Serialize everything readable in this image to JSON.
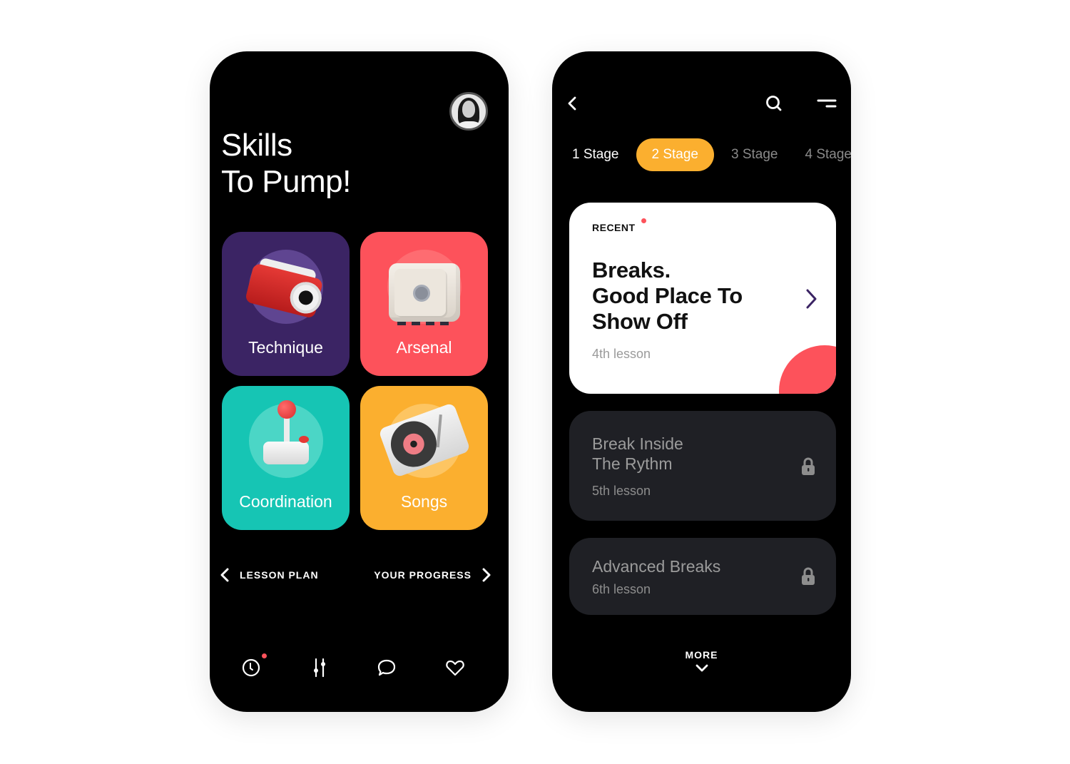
{
  "left_screen": {
    "title_lines": [
      "Skills",
      "To Pump!"
    ],
    "avatar": "user-avatar",
    "tiles": [
      {
        "label": "Technique",
        "icon": "camera-icon",
        "color": "#3b2464"
      },
      {
        "label": "Arsenal",
        "icon": "safe-icon",
        "color": "#fd525b"
      },
      {
        "label": "Coordination",
        "icon": "joystick-icon",
        "color": "#16c5b4"
      },
      {
        "label": "Songs",
        "icon": "turntable-icon",
        "color": "#fbaf2f"
      }
    ],
    "nav": {
      "prev_label": "LESSON PLAN",
      "next_label": "YOUR PROGRESS"
    },
    "tabbar": [
      {
        "icon": "clock-icon",
        "has_notification": true
      },
      {
        "icon": "sliders-icon"
      },
      {
        "icon": "chat-icon"
      },
      {
        "icon": "heart-icon"
      }
    ]
  },
  "right_screen": {
    "topbar": {
      "back_icon": "chevron-left-icon",
      "search_icon": "search-icon",
      "menu_icon": "menu-icon"
    },
    "stages": [
      {
        "label": "1 Stage",
        "state": "done"
      },
      {
        "label": "2 Stage",
        "state": "active"
      },
      {
        "label": "3 Stage",
        "state": "locked"
      },
      {
        "label": "4 Stage",
        "state": "locked"
      }
    ],
    "recent_card": {
      "badge": "RECENT",
      "title_lines": [
        "Breaks.",
        "Good Place To",
        "Show Off"
      ],
      "subtitle": "4th lesson"
    },
    "lessons": [
      {
        "title_lines": [
          "Break Inside",
          "The Rythm"
        ],
        "subtitle": "5th lesson",
        "locked": true
      },
      {
        "title_lines": [
          "Advanced Breaks"
        ],
        "subtitle": "6th lesson",
        "locked": true
      }
    ],
    "more_label": "MORE"
  },
  "colors": {
    "accent_yellow": "#fbaf2f",
    "accent_red": "#fd525b",
    "accent_purple": "#3b2464",
    "accent_teal": "#16c5b4",
    "dark_card": "#1f2025"
  }
}
